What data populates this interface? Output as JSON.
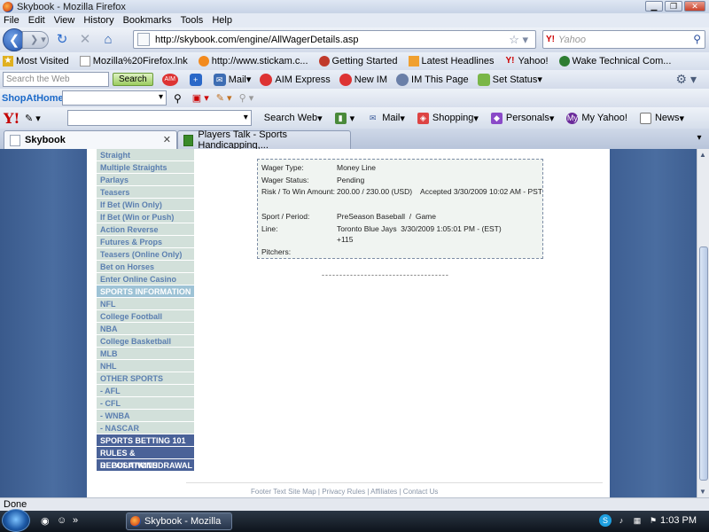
{
  "window": {
    "title": "Skybook - Mozilla Firefox"
  },
  "menu": [
    "File",
    "Edit",
    "View",
    "History",
    "Bookmarks",
    "Tools",
    "Help"
  ],
  "nav": {
    "url": "http://skybook.com/engine/AllWagerDetails.asp",
    "search_engine": "Y!",
    "search_placeholder": "Yahoo"
  },
  "bookmarks": [
    {
      "label": "Most Visited",
      "icon": "bookmark-star-icon"
    },
    {
      "label": "Mozilla%20Firefox.lnk",
      "icon": "page-icon"
    },
    {
      "label": "http://www.stickam.c...",
      "icon": "stickam-icon"
    },
    {
      "label": "Getting Started",
      "icon": "firefox-icon"
    },
    {
      "label": "Latest Headlines",
      "icon": "rss-icon"
    },
    {
      "label": "Yahoo!",
      "icon": "yahoo-icon"
    },
    {
      "label": "Wake Technical Com...",
      "icon": "globe-icon"
    }
  ],
  "toolbar1": {
    "search_placeholder": "Search the Web",
    "search_button": "Search",
    "aim_badge": "AIM",
    "mail": "Mail",
    "aim_express": "AIM Express",
    "new_im": "New IM",
    "im_page": "IM This Page",
    "set_status": "Set Status"
  },
  "toolbar2": {
    "brand": "ShopAtHome"
  },
  "yahoo_bar": {
    "logo": "Y!",
    "items": [
      {
        "label": "Search Web",
        "icon": "search-web-icon"
      },
      {
        "label": "Mail",
        "icon": "mail-icon"
      },
      {
        "label": "Shopping",
        "icon": "shopping-icon"
      },
      {
        "label": "Personals",
        "icon": "personals-icon"
      },
      {
        "label": "My Yahoo!",
        "icon": "my-yahoo-icon"
      },
      {
        "label": "News",
        "icon": "news-icon"
      }
    ]
  },
  "tabs": [
    {
      "label": "Skybook",
      "active": true
    },
    {
      "label": "Players Talk - Sports Handicapping,...",
      "active": false
    }
  ],
  "sidebar": [
    {
      "label": "Straight",
      "style": "light"
    },
    {
      "label": "Multiple Straights",
      "style": "light"
    },
    {
      "label": "Parlays",
      "style": "light"
    },
    {
      "label": "Teasers",
      "style": "light"
    },
    {
      "label": "If Bet (Win Only)",
      "style": "light"
    },
    {
      "label": "If Bet (Win or Push)",
      "style": "light"
    },
    {
      "label": "Action Reverse",
      "style": "light"
    },
    {
      "label": "Futures & Props",
      "style": "light"
    },
    {
      "label": "Teasers (Online Only)",
      "style": "light"
    },
    {
      "label": "Bet on Horses",
      "style": "light"
    },
    {
      "label": "Enter Online Casino",
      "style": "light"
    },
    {
      "label": "SPORTS INFORMATION",
      "style": "header-light"
    },
    {
      "label": "NFL",
      "style": "light"
    },
    {
      "label": "College Football",
      "style": "light"
    },
    {
      "label": "NBA",
      "style": "light"
    },
    {
      "label": "College Basketball",
      "style": "light"
    },
    {
      "label": "MLB",
      "style": "light"
    },
    {
      "label": "NHL",
      "style": "light"
    },
    {
      "label": "OTHER SPORTS",
      "style": "light"
    },
    {
      "label": "- AFL",
      "style": "light"
    },
    {
      "label": "- CFL",
      "style": "light"
    },
    {
      "label": "- WNBA",
      "style": "light"
    },
    {
      "label": "- NASCAR",
      "style": "light"
    },
    {
      "label": "SPORTS BETTING 101",
      "style": "header-dark"
    },
    {
      "label": "RULES & REGULATIONS",
      "style": "header-dark"
    },
    {
      "label": "DEPOSIT/WITHDRAWAL",
      "style": "header-dark"
    }
  ],
  "wager": {
    "type_label": "Wager Type:",
    "type_value": "Money Line",
    "status_label": "Wager Status:",
    "status_value": "Pending",
    "risk_label": "Risk / To Win Amount:",
    "risk_value": "200.00 / 230.00 (USD)    Accepted 3/30/2009 10:02 AM - PST",
    "sport_label": "Sport / Period:",
    "sport_value": "PreSeason Baseball  /  Game",
    "line_label": "Line:",
    "line_value": "Toronto Blue Jays  3/30/2009 1:05:01 PM - (EST)",
    "line_odds": "+115",
    "pitchers_label": "Pitchers:"
  },
  "dashes": "------------------------------------",
  "footer": "Footer Text Site Map | Privacy Rules | Affiliates | Contact Us",
  "status": "Done",
  "taskbar": {
    "window": "Skybook - Mozilla Fi...",
    "clock": "1:03 PM"
  }
}
